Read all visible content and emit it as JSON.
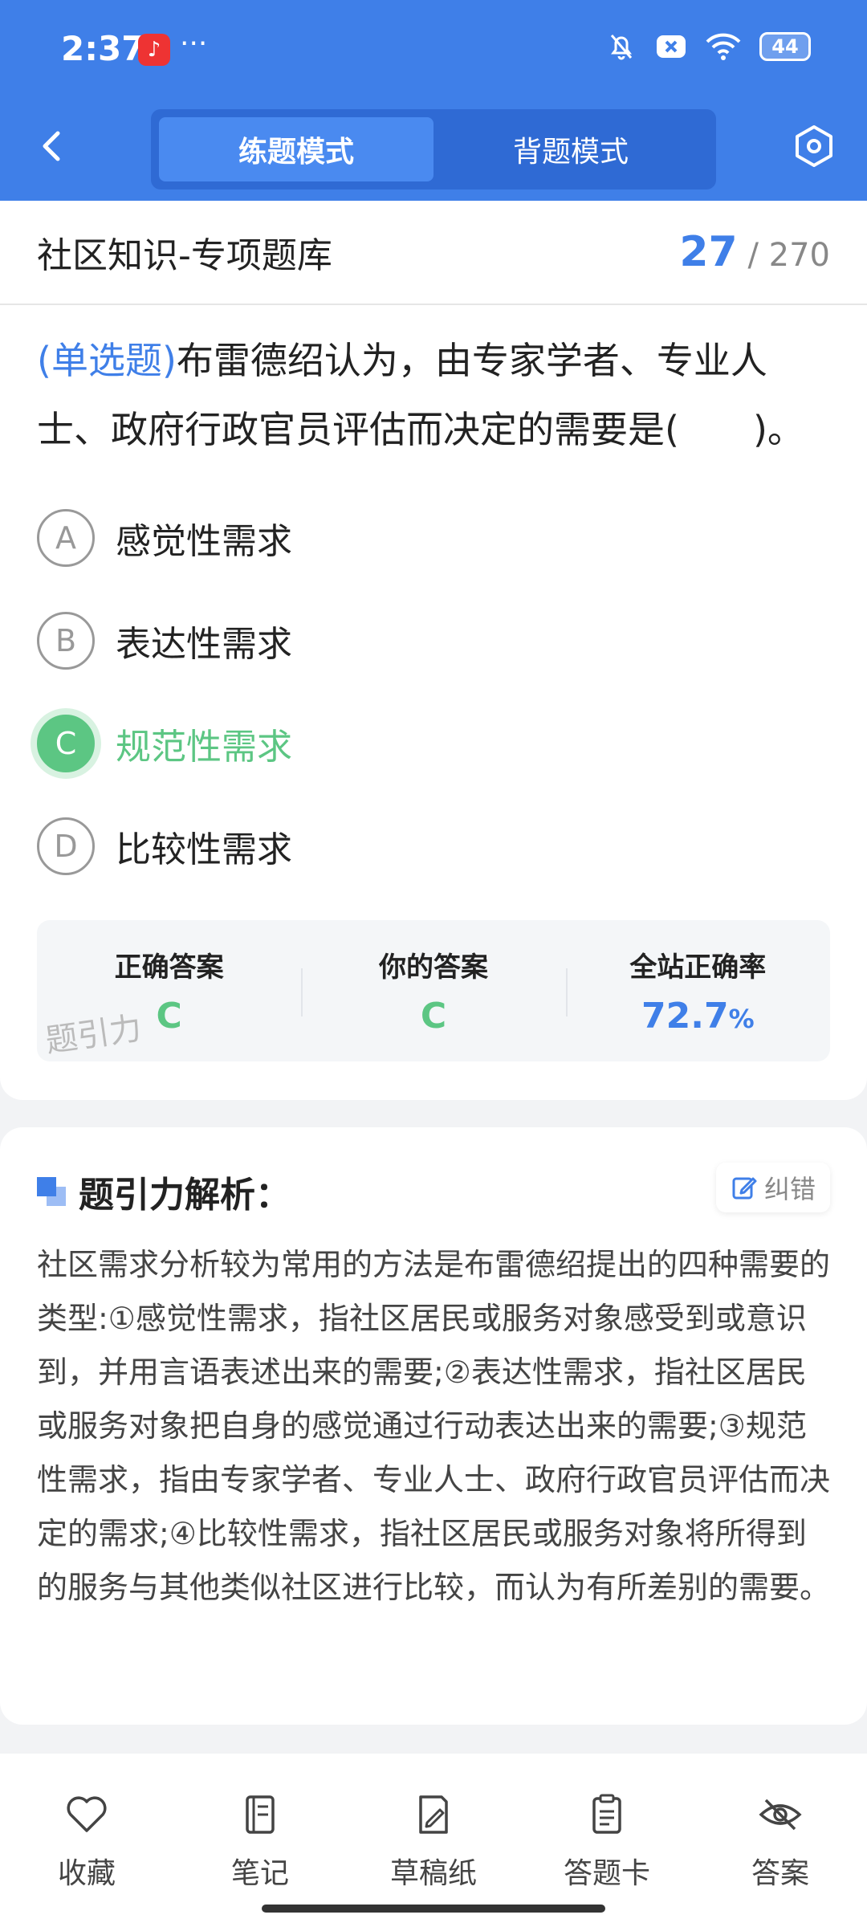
{
  "status": {
    "time": "2:37",
    "dots": "···",
    "battery": "44"
  },
  "header": {
    "tabs": [
      "练题模式",
      "背题模式"
    ]
  },
  "title": {
    "text": "社区知识-专项题库",
    "current": "27",
    "total": "270",
    "sep": "/"
  },
  "question": {
    "type": "(单选题)",
    "text": "布雷德绍认为，由专家学者、专业人士、政府行政官员评估而决定的需要是(　　)。"
  },
  "options": [
    {
      "letter": "A",
      "text": "感觉性需求"
    },
    {
      "letter": "B",
      "text": "表达性需求"
    },
    {
      "letter": "C",
      "text": "规范性需求"
    },
    {
      "letter": "D",
      "text": "比较性需求"
    }
  ],
  "answer": {
    "correct_label": "正确答案",
    "correct_value": "C",
    "yours_label": "你的答案",
    "yours_value": "C",
    "rate_label": "全站正确率",
    "rate_value": "72.7",
    "rate_unit": "%",
    "watermark": "题引力"
  },
  "analysis": {
    "title": "题引力解析：",
    "fix_label": "纠错",
    "text": "社区需求分析较为常用的方法是布雷德绍提出的四种需要的类型:①感觉性需求，指社区居民或服务对象感受到或意识到，并用言语表述出来的需要;②表达性需求，指社区居民或服务对象把自身的感觉通过行动表达出来的需要;③规范性需求，指由专家学者、专业人士、政府行政官员评估而决定的需求;④比较性需求，指社区居民或服务对象将所得到的服务与其他类似社区进行比较，而认为有所差别的需要。"
  },
  "toolbar": [
    "收藏",
    "笔记",
    "草稿纸",
    "答题卡",
    "答案"
  ],
  "colors": {
    "primary": "#3f7fe8",
    "correct": "#5cc683"
  }
}
